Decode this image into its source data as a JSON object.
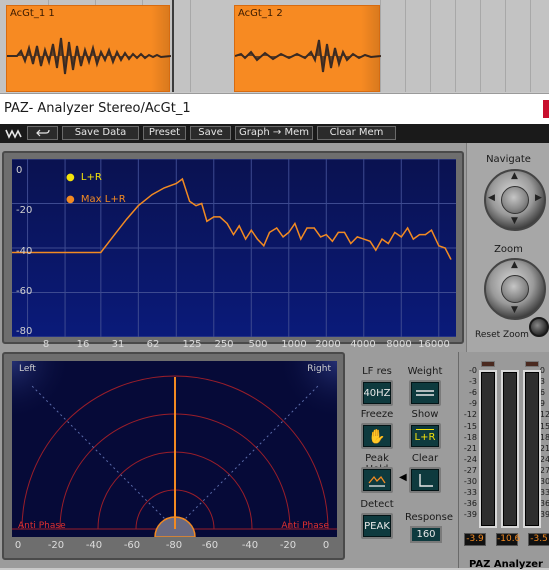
{
  "timeline": {
    "clips": [
      {
        "name": "AcGt_1 1"
      },
      {
        "name": "AcGt_1 2"
      }
    ]
  },
  "window": {
    "title": "PAZ- Analyzer Stereo/AcGt_1"
  },
  "toolbar": {
    "undo_icon": "undo-arrow",
    "save_data": "Save Data",
    "preset": "Preset",
    "save": "Save",
    "graph_mem": "Graph → Mem",
    "clear_mem": "Clear Mem"
  },
  "spectrum": {
    "y_labels": [
      "0",
      "-20",
      "-40",
      "-60",
      "-80"
    ],
    "x_labels": [
      "8",
      "16",
      "31",
      "62",
      "125",
      "250",
      "500",
      "1000",
      "2000",
      "4000",
      "8000",
      "16000"
    ],
    "legend": [
      {
        "label": "L+R",
        "color": "#f4e20a"
      },
      {
        "label": "Max L+R",
        "color": "#f28a22"
      }
    ]
  },
  "navigate": {
    "label": "Navigate",
    "zoom_label": "Zoom",
    "reset_zoom_label": "Reset Zoom"
  },
  "stereo": {
    "left_label": "Left",
    "right_label": "Right",
    "anti_phase_left": "Anti Phase",
    "anti_phase_right": "Anti Phase",
    "x_labels": [
      "0",
      "-20",
      "-40",
      "-60",
      "-80",
      "-60",
      "-40",
      "-20",
      "0"
    ]
  },
  "controls": {
    "lf_res_label": "LF res",
    "lf_res_value": "40HZ",
    "weight_label": "Weight",
    "freeze_label": "Freeze",
    "show_label": "Show",
    "show_value": "L+R",
    "peak_hold_label": "Peak Hold",
    "clear_label": "Clear",
    "detect_label": "Detect",
    "detect_value": "PEAK",
    "response_label": "Response",
    "response_value": "160"
  },
  "meters": {
    "scale": [
      "-0",
      "-3",
      "-6",
      "-9",
      "-12",
      "-15",
      "-18",
      "-21",
      "-24",
      "-27",
      "-30",
      "-33",
      "-36",
      "-39"
    ],
    "readouts": [
      "-3.9",
      "-10.6",
      "-3.5"
    ]
  },
  "footer": {
    "product": "PAZ Analyzer"
  },
  "colors": {
    "clip": "#f78a22",
    "display_bg": "#060a38",
    "trace": "#f28a22",
    "legend_lr": "#f4e20a",
    "anti_phase": "#e03030"
  },
  "chart_data": {
    "type": "line",
    "xlabel": "",
    "ylabel": "",
    "x_scale": "log",
    "x": [
      6,
      16,
      31,
      40,
      50,
      62,
      80,
      100,
      125,
      140,
      160,
      180,
      200,
      220,
      250,
      280,
      320,
      360,
      400,
      450,
      500,
      560,
      630,
      700,
      800,
      900,
      1000,
      1120,
      1250,
      1400,
      1600,
      1800,
      2000,
      2240,
      2500,
      2800,
      3150,
      3550,
      4000,
      4500,
      5000,
      5600,
      6300,
      7100,
      8000,
      9000,
      10000,
      11200,
      12500,
      14000,
      16000,
      18000,
      20000
    ],
    "series": [
      {
        "name": "Max L+R",
        "values": [
          -42,
          -42,
          -42,
          -34,
          -27,
          -21,
          -16,
          -13,
          -11,
          -9,
          -19,
          -21,
          -20,
          -28,
          -26,
          -26,
          -29,
          -34,
          -30,
          -36,
          -32,
          -36,
          -39,
          -33,
          -31,
          -35,
          -33,
          -29,
          -36,
          -31,
          -31,
          -35,
          -34,
          -37,
          -33,
          -33,
          -38,
          -35,
          -36,
          -37,
          -41,
          -36,
          -38,
          -33,
          -35,
          -31,
          -36,
          -34,
          -34,
          -32,
          -39,
          -40,
          -45
        ]
      }
    ],
    "ylim": [
      -80,
      0
    ],
    "xlim": [
      6,
      22000
    ]
  }
}
